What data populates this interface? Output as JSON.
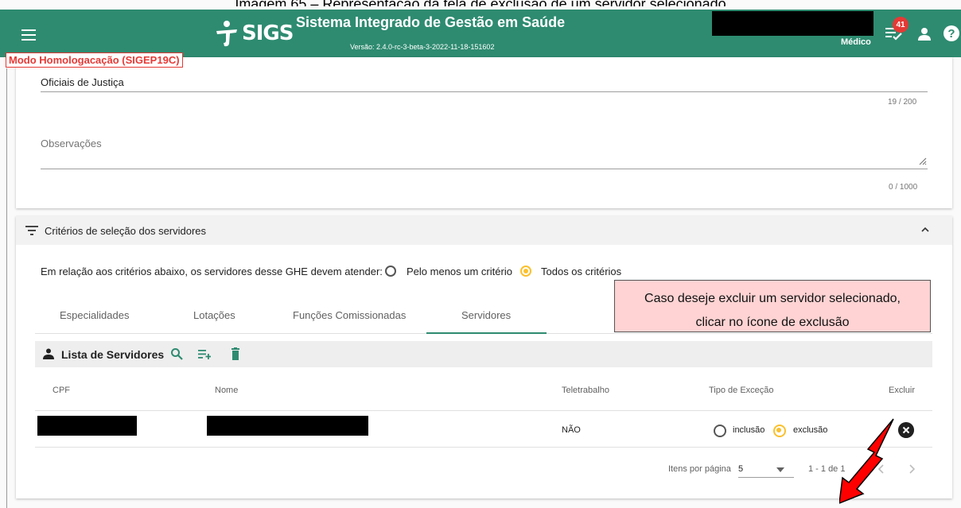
{
  "caption": "Imagem 65 – Representação da tela de exclusão de um servidor selecionado",
  "header": {
    "logo_text": "SIGS",
    "title": "Sistema Integrado de Gestão em Saúde",
    "version": "Versão: 2.4.0-rc-3-beta-3-2022-11-18-151602",
    "role": "Médico",
    "notification_count": "41",
    "help": "?"
  },
  "environment_label": "Modo Homologacação (SIGEP19C)",
  "form": {
    "description_value": "Oficiais de Justiça",
    "description_counter": "19 / 200",
    "observations_label": "Observações",
    "observations_counter": "0 / 1000"
  },
  "criteria": {
    "panel_title": "Critérios de seleção dos servidores",
    "prompt": "Em relação aos critérios abaixo, os servidores desse GHE devem atender:",
    "option_any": "Pelo menos um critério",
    "option_all": "Todos os critérios",
    "selected": "Todos os critérios"
  },
  "tabs": [
    "Especialidades",
    "Lotações",
    "Funções Comissionadas",
    "Servidores"
  ],
  "active_tab": "Servidores",
  "callout": {
    "line1": "Caso deseje excluir um servidor selecionado,",
    "line2": "clicar no ícone de exclusão"
  },
  "list": {
    "title": "Lista de Servidores",
    "columns": [
      "CPF",
      "Nome",
      "Teletrabalho",
      "Tipo de Exceção",
      "Excluir"
    ],
    "rows": [
      {
        "teletrabalho": "NÃO",
        "exception_inclusion": "inclusão",
        "exception_exclusion": "exclusão",
        "selected": "exclusão"
      }
    ]
  },
  "pagination": {
    "items_per_page_label": "Itens por página",
    "items_per_page": "5",
    "range": "1 - 1 de 1"
  },
  "colors": {
    "primary": "#2e8b70",
    "accent": "#fbc02d",
    "warning": "#e53935",
    "callout_bg": "#ffd3d3"
  }
}
